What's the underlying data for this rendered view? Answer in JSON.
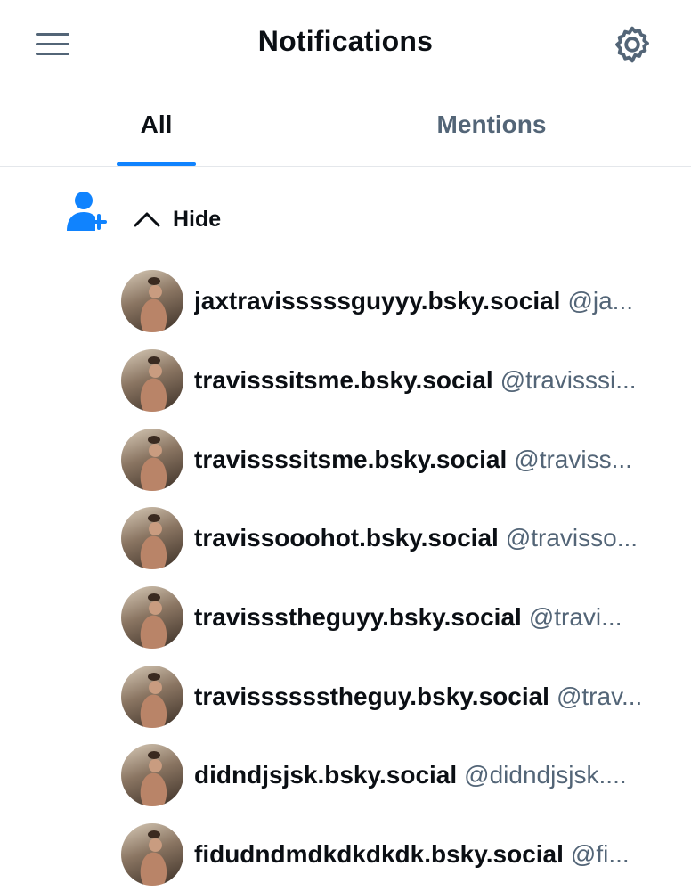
{
  "header": {
    "title": "Notifications"
  },
  "tabs": [
    {
      "label": "All"
    },
    {
      "label": "Mentions"
    }
  ],
  "colors": {
    "accent": "#1083fe",
    "muted": "#536577",
    "text": "#0b0f14"
  },
  "icons": {
    "menu": "hamburger-icon",
    "settings": "gear-icon",
    "follow": "person-plus-icon",
    "collapse": "chevron-up-icon"
  },
  "notification": {
    "toggle_label": "Hide",
    "users": [
      {
        "name": "jaxtravisssssguyyy.bsky.social",
        "handle": "@ja..."
      },
      {
        "name": "travisssitsme.bsky.social",
        "handle": "@travisssi..."
      },
      {
        "name": "travissssitsme.bsky.social",
        "handle": "@traviss..."
      },
      {
        "name": "travissooohot.bsky.social",
        "handle": "@travisso..."
      },
      {
        "name": "travissstheguyy.bsky.social",
        "handle": "@travi..."
      },
      {
        "name": "travisssssstheguy.bsky.social",
        "handle": "@trav..."
      },
      {
        "name": "didndjsjsk.bsky.social",
        "handle": "@didndjsjsk...."
      },
      {
        "name": "fidudndmdkdkdkdk.bsky.social",
        "handle": "@fi..."
      }
    ]
  }
}
